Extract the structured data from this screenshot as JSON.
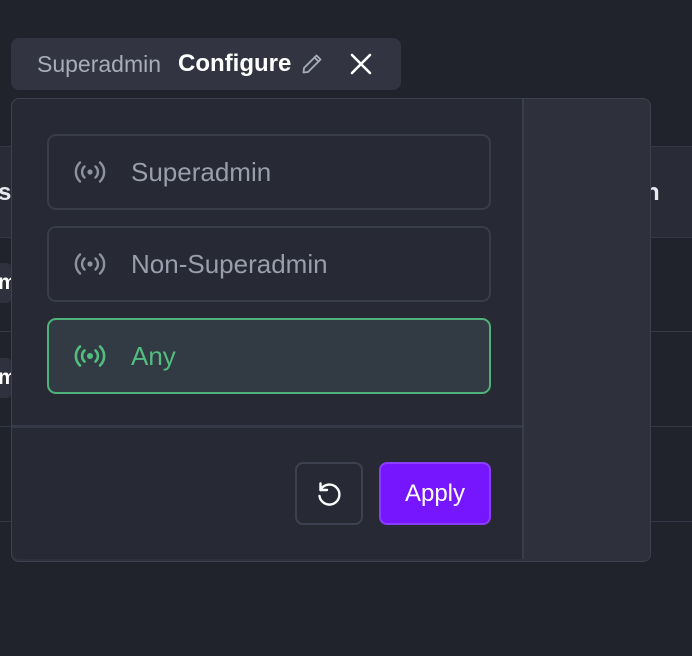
{
  "filter_tag": {
    "key": "Superadmin",
    "value": "Configure",
    "edit_icon": "pencil-icon",
    "close_icon": "close-icon"
  },
  "background_table": {
    "header_left_fragment": "s",
    "header_right_fragment": "n",
    "row1_fragment": "m",
    "row2_fragment": "m"
  },
  "popover": {
    "options": [
      {
        "label": "Superadmin",
        "icon": "broadcast-icon",
        "selected": false
      },
      {
        "label": "Non-Superadmin",
        "icon": "broadcast-icon",
        "selected": false
      },
      {
        "label": "Any",
        "icon": "broadcast-icon",
        "selected": true
      }
    ],
    "reset_icon": "reset-icon",
    "apply_label": "Apply"
  },
  "colors": {
    "background": "#21232c",
    "popover": "#272a35",
    "selected_accent": "#53bd80",
    "primary_button": "#7616ff"
  }
}
